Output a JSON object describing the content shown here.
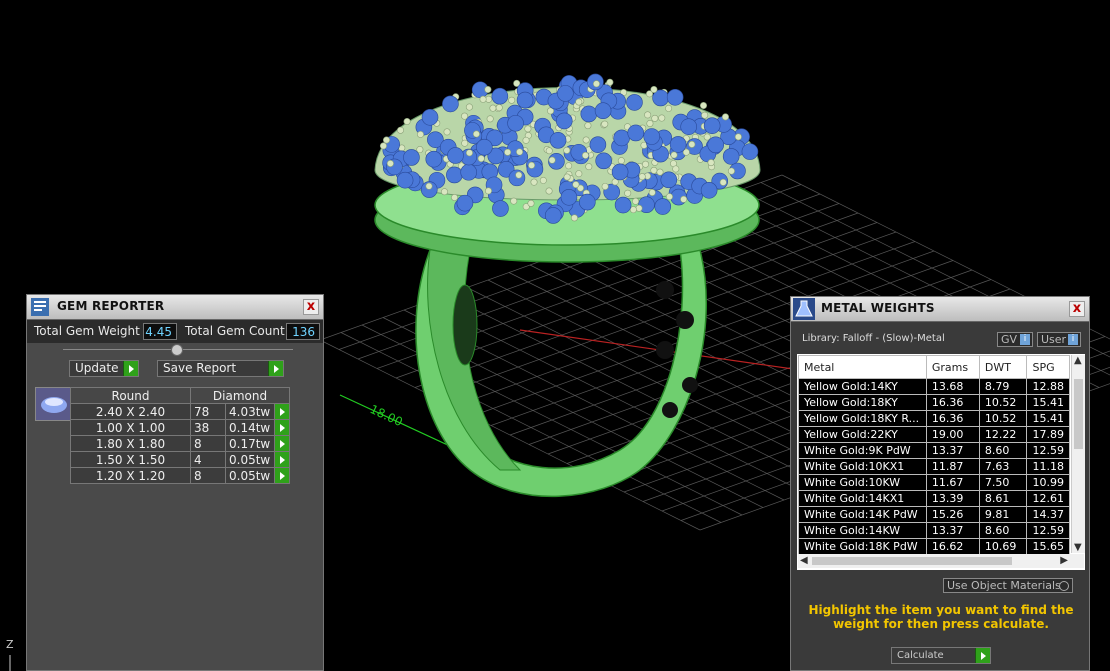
{
  "viewport": {
    "dimension_label": "18.00",
    "axis_label": "Z"
  },
  "gem_reporter": {
    "title": "GEM REPORTER",
    "close": "x",
    "total_weight_label": "Total Gem Weight",
    "total_weight_value": "4.45",
    "total_count_label": "Total Gem Count",
    "total_count_value": "136",
    "update_label": "Update",
    "save_label": "Save Report",
    "shape_header": "Round",
    "stone_header": "Diamond",
    "rows": [
      {
        "size": "2.40 X 2.40",
        "count": "78",
        "weight": "4.03tw"
      },
      {
        "size": "1.00 X 1.00",
        "count": "38",
        "weight": "0.14tw"
      },
      {
        "size": "1.80 X 1.80",
        "count": "8",
        "weight": "0.17tw"
      },
      {
        "size": "1.50 X 1.50",
        "count": "4",
        "weight": "0.05tw"
      },
      {
        "size": "1.20 X 1.20",
        "count": "8",
        "weight": "0.05tw"
      }
    ]
  },
  "metal_weights": {
    "title": "METAL WEIGHTS",
    "close": "x",
    "library": "Library: Falloff - (Slow)-Metal",
    "gv_label": "GV",
    "user_label": "User",
    "columns": [
      "Metal",
      "Grams",
      "DWT",
      "SPG"
    ],
    "rows": [
      [
        "Yellow Gold:14KY",
        "13.68",
        "8.79",
        "12.88"
      ],
      [
        "Yellow Gold:18KY",
        "16.36",
        "10.52",
        "15.41"
      ],
      [
        "Yellow Gold:18KY R...",
        "16.36",
        "10.52",
        "15.41"
      ],
      [
        "Yellow Gold:22KY",
        "19.00",
        "12.22",
        "17.89"
      ],
      [
        "White Gold:9K PdW",
        "13.37",
        "8.60",
        "12.59"
      ],
      [
        "White Gold:10KX1",
        "11.87",
        "7.63",
        "11.18"
      ],
      [
        "White Gold:10KW",
        "11.67",
        "7.50",
        "10.99"
      ],
      [
        "White Gold:14KX1",
        "13.39",
        "8.61",
        "12.61"
      ],
      [
        "White Gold:14K PdW",
        "15.26",
        "9.81",
        "14.37"
      ],
      [
        "White Gold:14KW",
        "13.37",
        "8.60",
        "12.59"
      ],
      [
        "White Gold:18K PdW",
        "16.62",
        "10.69",
        "15.65"
      ]
    ],
    "use_object_materials": "Use Object Materials",
    "note": "Highlight the item you want to find the weight for then press calculate.",
    "calculate_label": "Calculate"
  },
  "colors": {
    "ring": "#7ee07e",
    "gem": "#4a78d8",
    "accent": "#2fa11a",
    "note": "#f2c500"
  }
}
